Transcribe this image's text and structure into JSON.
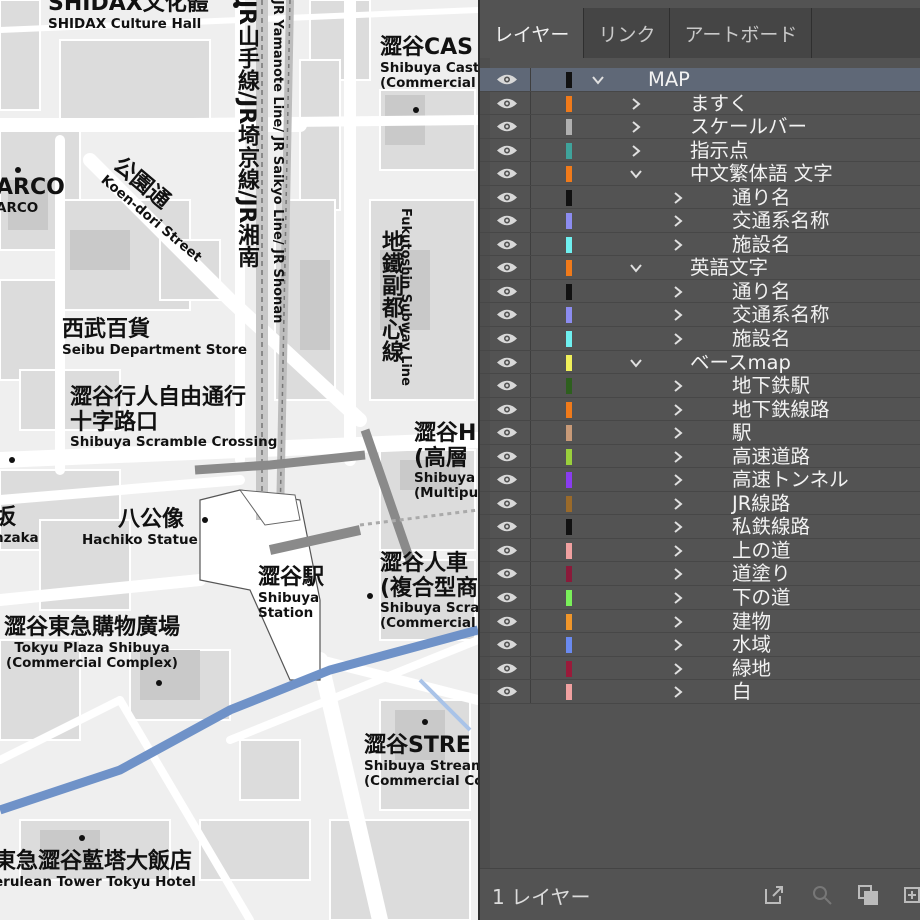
{
  "map": {
    "labels": {
      "shidax_zh": "SHIDAX文化體",
      "shidax_en": "SHIDAX Culture Hall",
      "cast_zh": "澀谷CAS",
      "cast_en1": "Shibuya Cast",
      "cast_en2": "(Commercial",
      "parco_zh": "ARCO",
      "parco_en": "ARCO",
      "koen_zh": "公園通",
      "koen_en": "Koen-dori Street",
      "jr_zh": "JR山手線/JR埼京線/JR湘南",
      "jr_en": "JR Yamanote Line/ JR Saikyo Line/ JR Shonan",
      "fuku_zh": "地鐵副都心線",
      "fuku_en": "Fukutoshin Subway Line",
      "seibu_zh": "西武百貨",
      "seibu_en": "Seibu Department Store",
      "crossing_zh1": "澀谷行人自由通行",
      "crossing_zh2": "十字路口",
      "crossing_en": "Shibuya Scramble Crossing",
      "hikarie_zh1": "澀谷Hi",
      "hikarie_zh2": "(高層",
      "hikarie_en1": "Shibuya",
      "hikarie_en2": "(Multipu",
      "saka_zh": "坂",
      "saka_en": "nzaka",
      "hachiko_zh": "八公像",
      "hachiko_en": "Hachiko Statue",
      "station_zh": "澀谷駅",
      "station_en1": "Shibuya",
      "station_en2": "Station",
      "scramble_zh1": "澀谷人車",
      "scramble_zh2": "(複合型商",
      "scramble_en1": "Shibuya Scra",
      "scramble_en2": "(Commercial",
      "tokyu_zh": "澀谷東急購物廣場",
      "tokyu_en1": "Tokyu Plaza Shibuya",
      "tokyu_en2": "(Commercial Complex)",
      "stream_zh": "澀谷STRE",
      "stream_en1": "Shibuya Stream",
      "stream_en2": "(Commercial Co",
      "cerulean_zh": "東急澀谷藍塔大飯店",
      "cerulean_en": "erulean Tower Tokyu Hotel"
    }
  },
  "panel": {
    "tabs": [
      "レイヤー",
      "リンク",
      "アートボード"
    ],
    "active_tab": "レイヤー",
    "layers": [
      {
        "name": "MAP",
        "color": "#111111",
        "depth": 0,
        "expanded": true,
        "selected": true
      },
      {
        "name": "ますく",
        "color": "#f07a1a",
        "depth": 1,
        "expanded": false
      },
      {
        "name": "スケールバー",
        "color": "#b0b0b0",
        "depth": 1,
        "expanded": false
      },
      {
        "name": "指示点",
        "color": "#3fa39b",
        "depth": 1,
        "expanded": false
      },
      {
        "name": "中文繁体語 文字",
        "color": "#f07a1a",
        "depth": 1,
        "expanded": true
      },
      {
        "name": "通り名",
        "color": "#111111",
        "depth": 2,
        "expanded": false
      },
      {
        "name": "交通系名称",
        "color": "#8c8cf0",
        "depth": 2,
        "expanded": false
      },
      {
        "name": "施設名",
        "color": "#6ff0f0",
        "depth": 2,
        "expanded": false
      },
      {
        "name": "英語文字",
        "color": "#f07a1a",
        "depth": 1,
        "expanded": true
      },
      {
        "name": "通り名",
        "color": "#111111",
        "depth": 2,
        "expanded": false
      },
      {
        "name": "交通系名称",
        "color": "#8c8cf0",
        "depth": 2,
        "expanded": false
      },
      {
        "name": "施設名",
        "color": "#6ff0f0",
        "depth": 2,
        "expanded": false
      },
      {
        "name": "ベースmap",
        "color": "#f0f05a",
        "depth": 1,
        "expanded": true
      },
      {
        "name": "地下鉄駅",
        "color": "#2e5f1e",
        "depth": 2,
        "expanded": false
      },
      {
        "name": "地下鉄線路",
        "color": "#f07a1a",
        "depth": 2,
        "expanded": false
      },
      {
        "name": "駅",
        "color": "#c89a78",
        "depth": 2,
        "expanded": false
      },
      {
        "name": "高速道路",
        "color": "#9ad03c",
        "depth": 2,
        "expanded": false
      },
      {
        "name": "高速トンネル",
        "color": "#8a3cf0",
        "depth": 2,
        "expanded": false
      },
      {
        "name": "JR線路",
        "color": "#9a6a2a",
        "depth": 2,
        "expanded": false
      },
      {
        "name": "私鉄線路",
        "color": "#111111",
        "depth": 2,
        "expanded": false
      },
      {
        "name": "上の道",
        "color": "#f0a0a0",
        "depth": 2,
        "expanded": false
      },
      {
        "name": "道塗り",
        "color": "#8a1a3a",
        "depth": 2,
        "expanded": false
      },
      {
        "name": "下の道",
        "color": "#7af05a",
        "depth": 2,
        "expanded": false
      },
      {
        "name": "建物",
        "color": "#f0962a",
        "depth": 2,
        "expanded": false
      },
      {
        "name": "水域",
        "color": "#6a8af0",
        "depth": 2,
        "expanded": false
      },
      {
        "name": "緑地",
        "color": "#9a1a3a",
        "depth": 2,
        "expanded": false
      },
      {
        "name": "白",
        "color": "#f0a0a0",
        "depth": 2,
        "expanded": false
      }
    ],
    "footer": {
      "layer_count": "1 レイヤー",
      "icons": [
        "export-icon",
        "search-icon",
        "arrange-icon",
        "new-layer-icon"
      ]
    }
  }
}
